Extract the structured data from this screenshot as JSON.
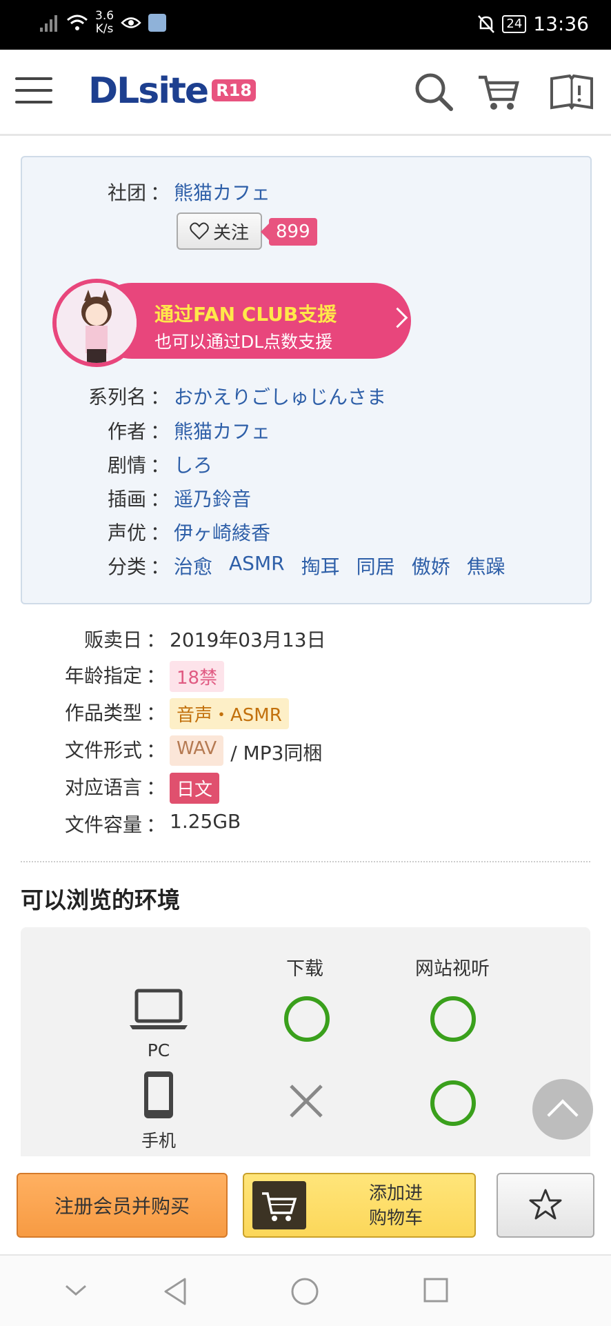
{
  "status_bar": {
    "speed_value": "3.6",
    "speed_unit": "K/s",
    "battery": "24",
    "time": "13:36"
  },
  "header": {
    "logo_text": "DLsite",
    "logo_badge": "R18"
  },
  "circle_info": {
    "circle_label": "社团",
    "circle_value": "熊猫カフェ",
    "follow_label": "关注",
    "follow_count": "899",
    "fanclub_title": "通过FAN CLUB支援",
    "fanclub_subtitle": "也可以通过DL点数支援",
    "rows": [
      {
        "label": "系列名",
        "value": "おかえりごしゅじんさま"
      },
      {
        "label": "作者",
        "value": "熊猫カフェ"
      },
      {
        "label": "剧情",
        "value": "しろ"
      },
      {
        "label": "插画",
        "value": "遥乃鈴音"
      },
      {
        "label": "声优",
        "value": "伊ヶ崎綾香"
      }
    ],
    "genre_label": "分类",
    "genres": [
      "治愈",
      "ASMR",
      "掏耳",
      "同居",
      "傲娇",
      "焦躁"
    ]
  },
  "meta": {
    "release_label": "贩卖日",
    "release_value": "2019年03月13日",
    "age_label": "年龄指定",
    "age_value": "18禁",
    "type_label": "作品类型",
    "type_value": "音声・ASMR",
    "format_label": "文件形式",
    "format_tag": "WAV",
    "format_extra": "/ MP3同梱",
    "lang_label": "对应语言",
    "lang_value": "日文",
    "size_label": "文件容量",
    "size_value": "1.25GB"
  },
  "env": {
    "title": "可以浏览的环境",
    "col_download": "下载",
    "col_web": "网站视听",
    "pc_label": "PC",
    "mobile_label": "手机"
  },
  "actions": {
    "register_label": "注册会员并购买",
    "cart_line1": "添加进",
    "cart_line2": "购物车"
  },
  "colors": {
    "brand_blue": "#1d3f8f",
    "pink": "#e8467c",
    "ok_green": "#3aa01c"
  }
}
